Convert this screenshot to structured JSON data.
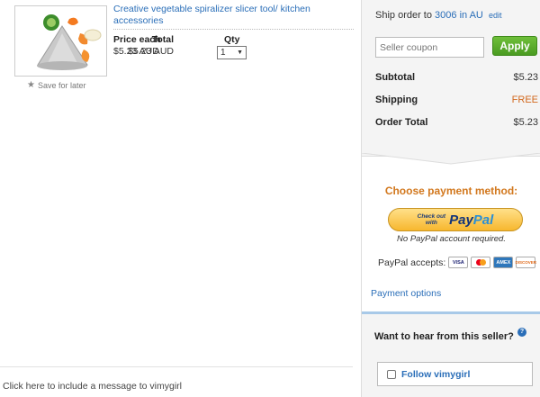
{
  "item": {
    "title": "Creative vegetable spiralizer slicer tool/ kitchen accessories",
    "save_for_later": "Save for later",
    "price_label": "Price each",
    "price_value": "$5.23 AUD",
    "qty_label": "Qty",
    "qty_value": "1",
    "total_label": "Total",
    "total_value": "$5.23 AUD",
    "image_icon": "product-photo-spiralizer"
  },
  "message_link": "Click here to include a message to vimygirl",
  "summary": {
    "ship_prefix": "Ship order to",
    "ship_location": "3006 in AU",
    "edit_label": "edit",
    "coupon_placeholder": "Seller coupon",
    "apply_label": "Apply",
    "subtotal_label": "Subtotal",
    "subtotal_value": "$5.23",
    "shipping_label": "Shipping",
    "shipping_value": "FREE",
    "order_total_label": "Order Total",
    "order_total_value": "$5.23"
  },
  "payment": {
    "title": "Choose payment method:",
    "paypal_checkout_line1": "Check out",
    "paypal_checkout_line2": "with",
    "paypal_pay": "Pay",
    "paypal_pal": "Pal",
    "no_account": "No PayPal account required.",
    "accepts_label": "PayPal accepts:",
    "cards": [
      "VISA",
      "MC",
      "AMEX",
      "DISCOVER"
    ],
    "options_link": "Payment options"
  },
  "seller": {
    "question": "Want to hear from this seller?",
    "follow_label": "Follow vimygirl"
  },
  "colors": {
    "link": "#2a6eb8",
    "accent_orange": "#d2781e",
    "apply_green": "#4a9b21"
  }
}
